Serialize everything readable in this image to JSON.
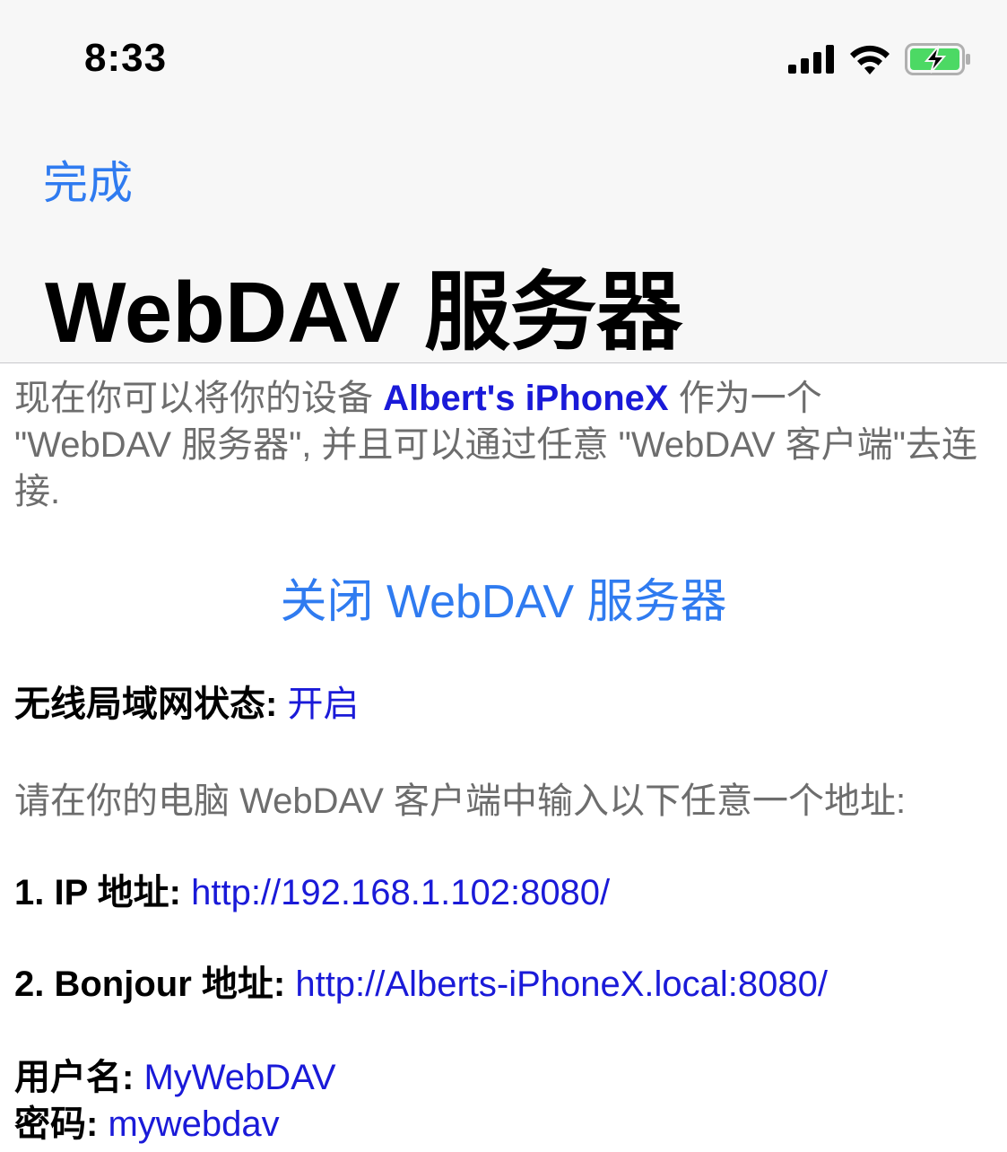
{
  "status_bar": {
    "time": "8:33",
    "icons": [
      "signal-icon",
      "wifi-icon",
      "battery-charging-icon"
    ],
    "battery_color": "#4cd964"
  },
  "nav": {
    "done_label": "完成",
    "title": "WebDAV 服务器"
  },
  "intro": {
    "before": "现在你可以将你的设备 ",
    "device_name": "Albert's iPhoneX",
    "after": " 作为一个 \"WebDAV 服务器\", 并且可以通过任意 \"WebDAV 客户端\"去连接."
  },
  "close_server_label": "关闭 WebDAV 服务器",
  "wifi_status": {
    "label": "无线局域网状态: ",
    "value": "开启"
  },
  "instruction": "请在你的电脑 WebDAV 客户端中输入以下任意一个地址:",
  "ip_address": {
    "label": "1. IP 地址: ",
    "value": "http://192.168.1.102:8080/"
  },
  "bonjour_address": {
    "label": "2. Bonjour 地址: ",
    "value": "http://Alberts-iPhoneX.local:8080/"
  },
  "username": {
    "label": "用户名: ",
    "value": "MyWebDAV"
  },
  "password": {
    "label": "密码: ",
    "value": "mywebdav"
  },
  "colors": {
    "accent_blue": "#2f7bf0",
    "link_blue": "#1a1ad8",
    "secondary_text": "#6d6d6d",
    "header_bg": "#f7f7f7"
  }
}
